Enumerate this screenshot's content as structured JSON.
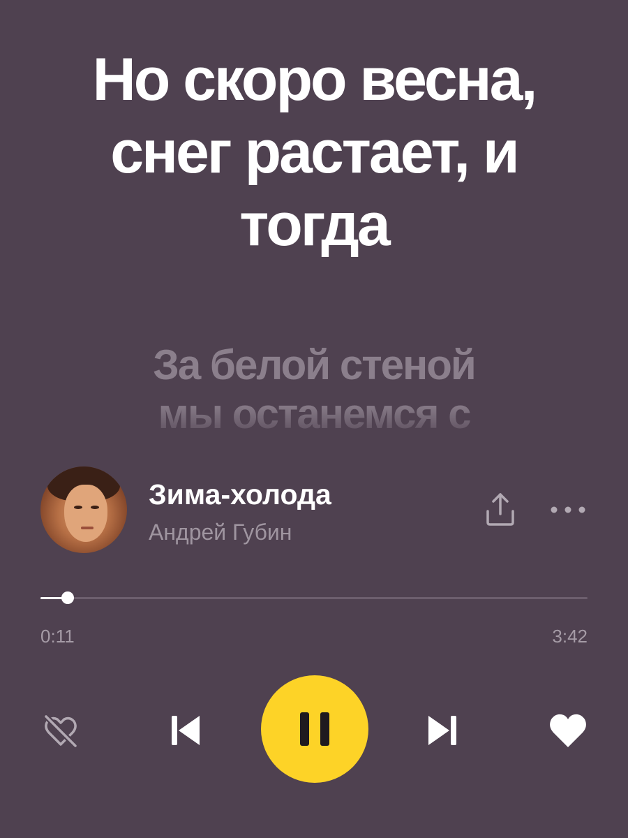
{
  "lyrics": {
    "current": [
      "Но скоро весна,",
      "снег растает, и",
      "тогда"
    ],
    "next": [
      "За белой стеной",
      "мы останемся с"
    ]
  },
  "track": {
    "title": "Зима-холода",
    "artist": "Андрей Губин",
    "cover_icon": "album-cover-photo"
  },
  "actions": {
    "share_icon": "share-upload-icon",
    "more_icon": "more-dots-icon"
  },
  "playback": {
    "elapsed": "0:11",
    "total": "3:42",
    "progress_fraction": 0.0495,
    "state": "playing"
  },
  "controls": {
    "dislike_icon": "dislike-broken-heart-icon",
    "prev_icon": "skip-previous-icon",
    "play_pause_icon": "pause-icon",
    "next_icon": "skip-next-icon",
    "like_icon": "heart-icon"
  },
  "colors": {
    "background": "#4f4150",
    "accent": "#fdd327",
    "lyrics_active": "#ffffff",
    "lyrics_upcoming": "#8b7f8c",
    "secondary_text": "#9f95a0"
  }
}
